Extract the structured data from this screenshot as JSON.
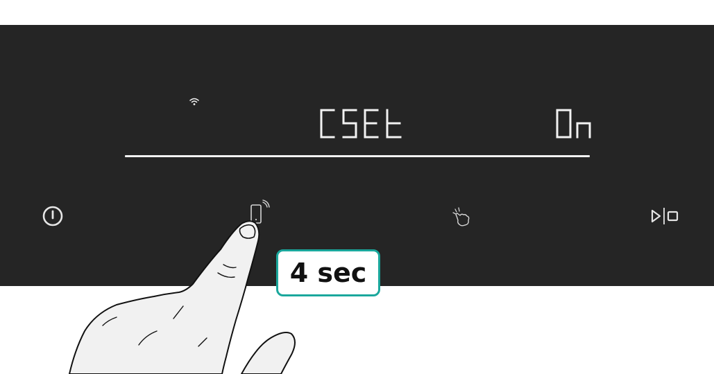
{
  "display": {
    "program_code": "CSEt",
    "state_value": "On",
    "wifi_indicator": "wifi-icon"
  },
  "controls": {
    "power": "power-icon",
    "remote_start": "remote-start-icon",
    "child_lock": "child-lock-icon",
    "start_pause": "start-pause-icon"
  },
  "callout": {
    "duration_label": "4 sec",
    "border_color": "#1aa79c"
  },
  "colors": {
    "panel": "#252525",
    "display_segments": "#f2f2f2",
    "icons": "#d6d6d6"
  }
}
